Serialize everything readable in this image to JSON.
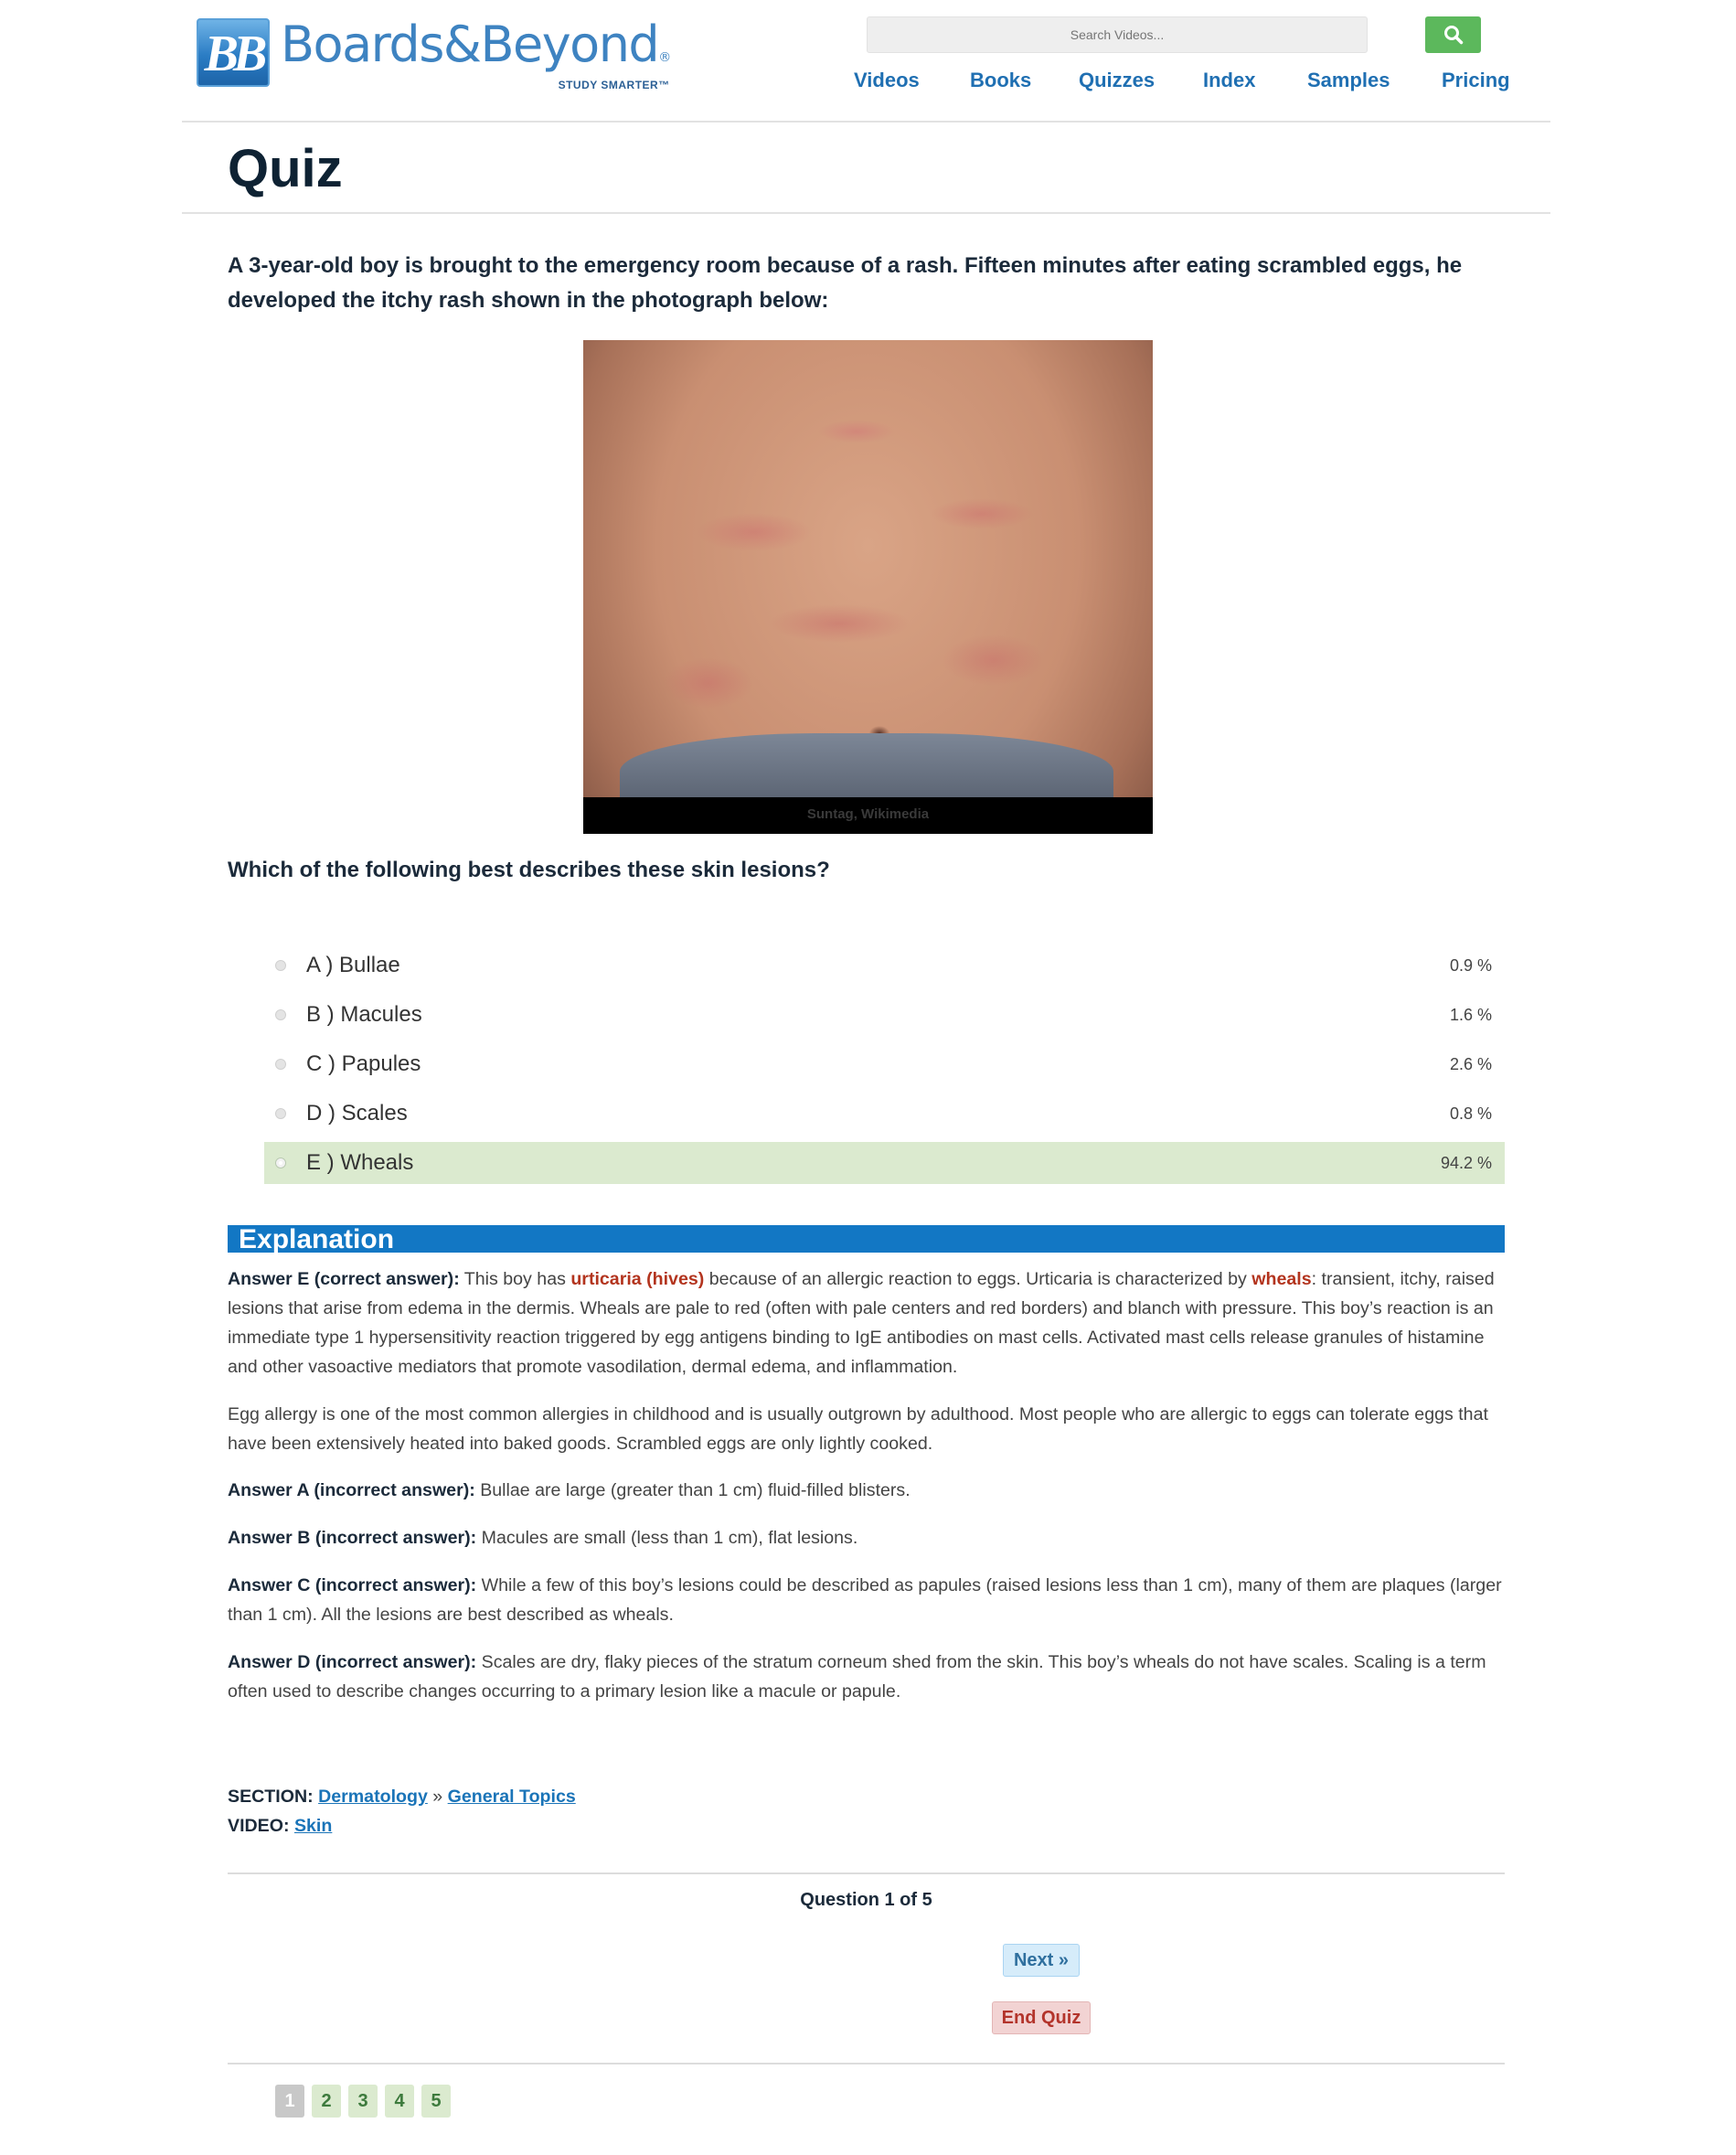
{
  "header": {
    "logo_mark": "BB",
    "logo_word": "Boards&Beyond",
    "logo_registered": "®",
    "logo_tagline": "STUDY SMARTER™",
    "search_placeholder": "Search Videos...",
    "search_icon": "search-icon",
    "nav": [
      "Videos",
      "Books",
      "Quizzes",
      "Index",
      "Samples",
      "Pricing"
    ]
  },
  "page_title": "Quiz",
  "question": {
    "stem": "A 3-year-old boy is brought to the emergency room because of a rash. Fifteen minutes after eating scrambled eggs, he developed the itchy rash shown in the photograph below:",
    "image_credit": "Suntag, Wikimedia",
    "prompt": "Which of the following best describes these skin lesions?",
    "options": [
      {
        "label": "A ) Bullae",
        "percent": "0.9 %",
        "selected": false
      },
      {
        "label": "B ) Macules",
        "percent": "1.6 %",
        "selected": false
      },
      {
        "label": "C ) Papules",
        "percent": "2.6 %",
        "selected": false
      },
      {
        "label": "D ) Scales",
        "percent": "0.8 %",
        "selected": false
      },
      {
        "label": "E ) Wheals",
        "percent": "94.2 %",
        "selected": true
      }
    ]
  },
  "explanation": {
    "heading": "Explanation",
    "p1": {
      "lead": "Answer E (correct answer):",
      "t1": " This boy has ",
      "hl1": "urticaria (hives)",
      "t2": " because of an allergic reaction to eggs. Urticaria is characterized by ",
      "hl2": "wheals",
      "t3": ": transient, itchy, raised lesions that arise from edema in the dermis. Wheals are pale to red (often with pale centers and red borders) and blanch with pressure. This boy’s reaction is an immediate type 1 hypersensitivity reaction triggered by egg antigens binding to IgE antibodies on mast cells. Activated mast cells release granules of histamine and other vasoactive mediators that promote vasodilation, dermal edema, and inflammation."
    },
    "p2": "Egg allergy is one of the most common allergies in childhood and is usually outgrown by adulthood. Most people who are allergic to eggs can tolerate eggs that have been extensively heated into baked goods. Scrambled eggs are only lightly cooked.",
    "p3": {
      "lead": "Answer A (incorrect answer):",
      "text": " Bullae are large (greater than 1 cm) fluid-filled blisters."
    },
    "p4": {
      "lead": "Answer B (incorrect answer):",
      "text": " Macules are small (less than 1 cm), flat lesions."
    },
    "p5": {
      "lead": "Answer C (incorrect answer):",
      "text": " While a few of this boy’s lesions could be described as papules (raised lesions less than 1 cm), many of them are plaques (larger than 1 cm). All the lesions are best described as wheals."
    },
    "p6": {
      "lead": "Answer D (incorrect answer):",
      "text": " Scales are dry, flaky pieces of the stratum corneum shed from the skin. This boy’s wheals do not have scales. Scaling is a term often used to describe changes occurring to a primary lesion like a macule or papule."
    }
  },
  "meta": {
    "section_label": "SECTION:",
    "section_link1": "Dermatology",
    "separator": " » ",
    "section_link2": "General Topics",
    "video_label": "VIDEO:",
    "video_link": "Skin"
  },
  "footer": {
    "question_counter": "Question 1 of 5",
    "next_label": "Next »",
    "end_label": "End Quiz",
    "pages": [
      "1",
      "2",
      "3",
      "4",
      "5"
    ],
    "current_page": "1"
  },
  "colors": {
    "nav": "#1f6fb2",
    "explanation_bar": "#1277c4",
    "selected_option": "#dbeacf",
    "search_button": "#5cb85c",
    "highlight_red": "#b3341e"
  }
}
